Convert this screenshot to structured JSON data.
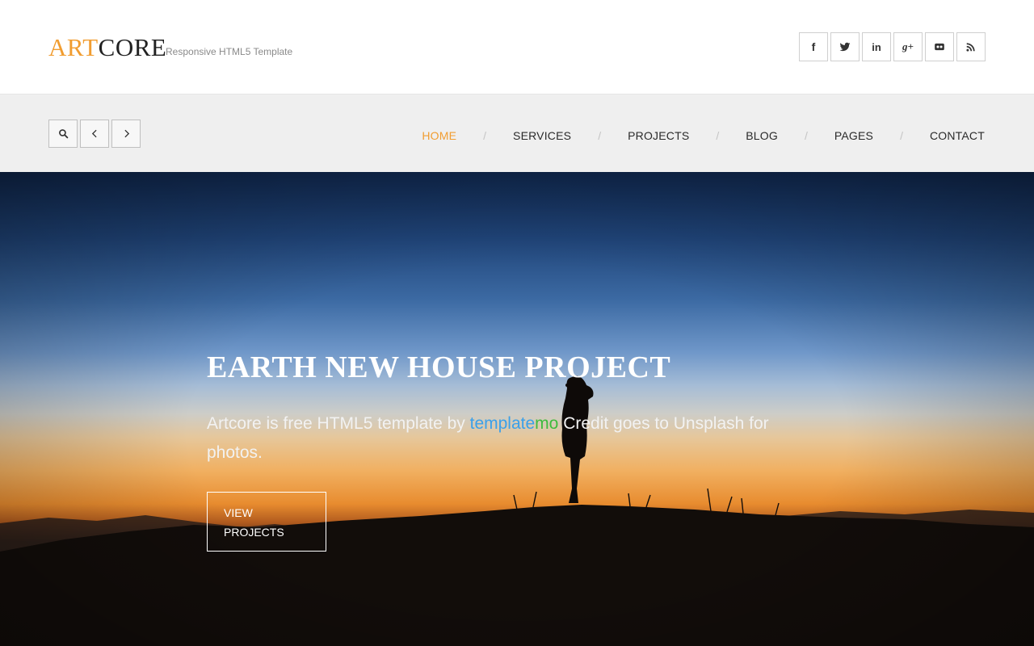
{
  "logo": {
    "part1": "ART",
    "part2": "CORE",
    "tagline": "Responsive HTML5 Template"
  },
  "social": [
    {
      "icon": "facebook-icon",
      "glyph": "f"
    },
    {
      "icon": "twitter-icon",
      "glyph": ""
    },
    {
      "icon": "linkedin-icon",
      "glyph": "in"
    },
    {
      "icon": "google-plus-icon",
      "glyph": "g+"
    },
    {
      "icon": "flickr-icon",
      "glyph": ""
    },
    {
      "icon": "rss-icon",
      "glyph": ""
    }
  ],
  "controls": {
    "search_icon": "search-icon",
    "prev_icon": "chevron-left-icon",
    "next_icon": "chevron-right-icon"
  },
  "nav": {
    "active": "HOME",
    "items": [
      "HOME",
      "SERVICES",
      "PROJECTS",
      "BLOG",
      "PAGES",
      "CONTACT"
    ],
    "separator": "/"
  },
  "hero": {
    "title": "EARTH NEW HOUSE PROJECT",
    "text_before": "Artcore is free HTML5 template by ",
    "brand_part1": "template",
    "brand_part2": "mo",
    "text_after": " Credit goes to Unsplash for photos.",
    "button_label": "VIEW PROJECTS"
  },
  "colors": {
    "accent": "#f19d31",
    "brand_blue": "#3aa0ea",
    "brand_green": "#3dbb3d"
  }
}
